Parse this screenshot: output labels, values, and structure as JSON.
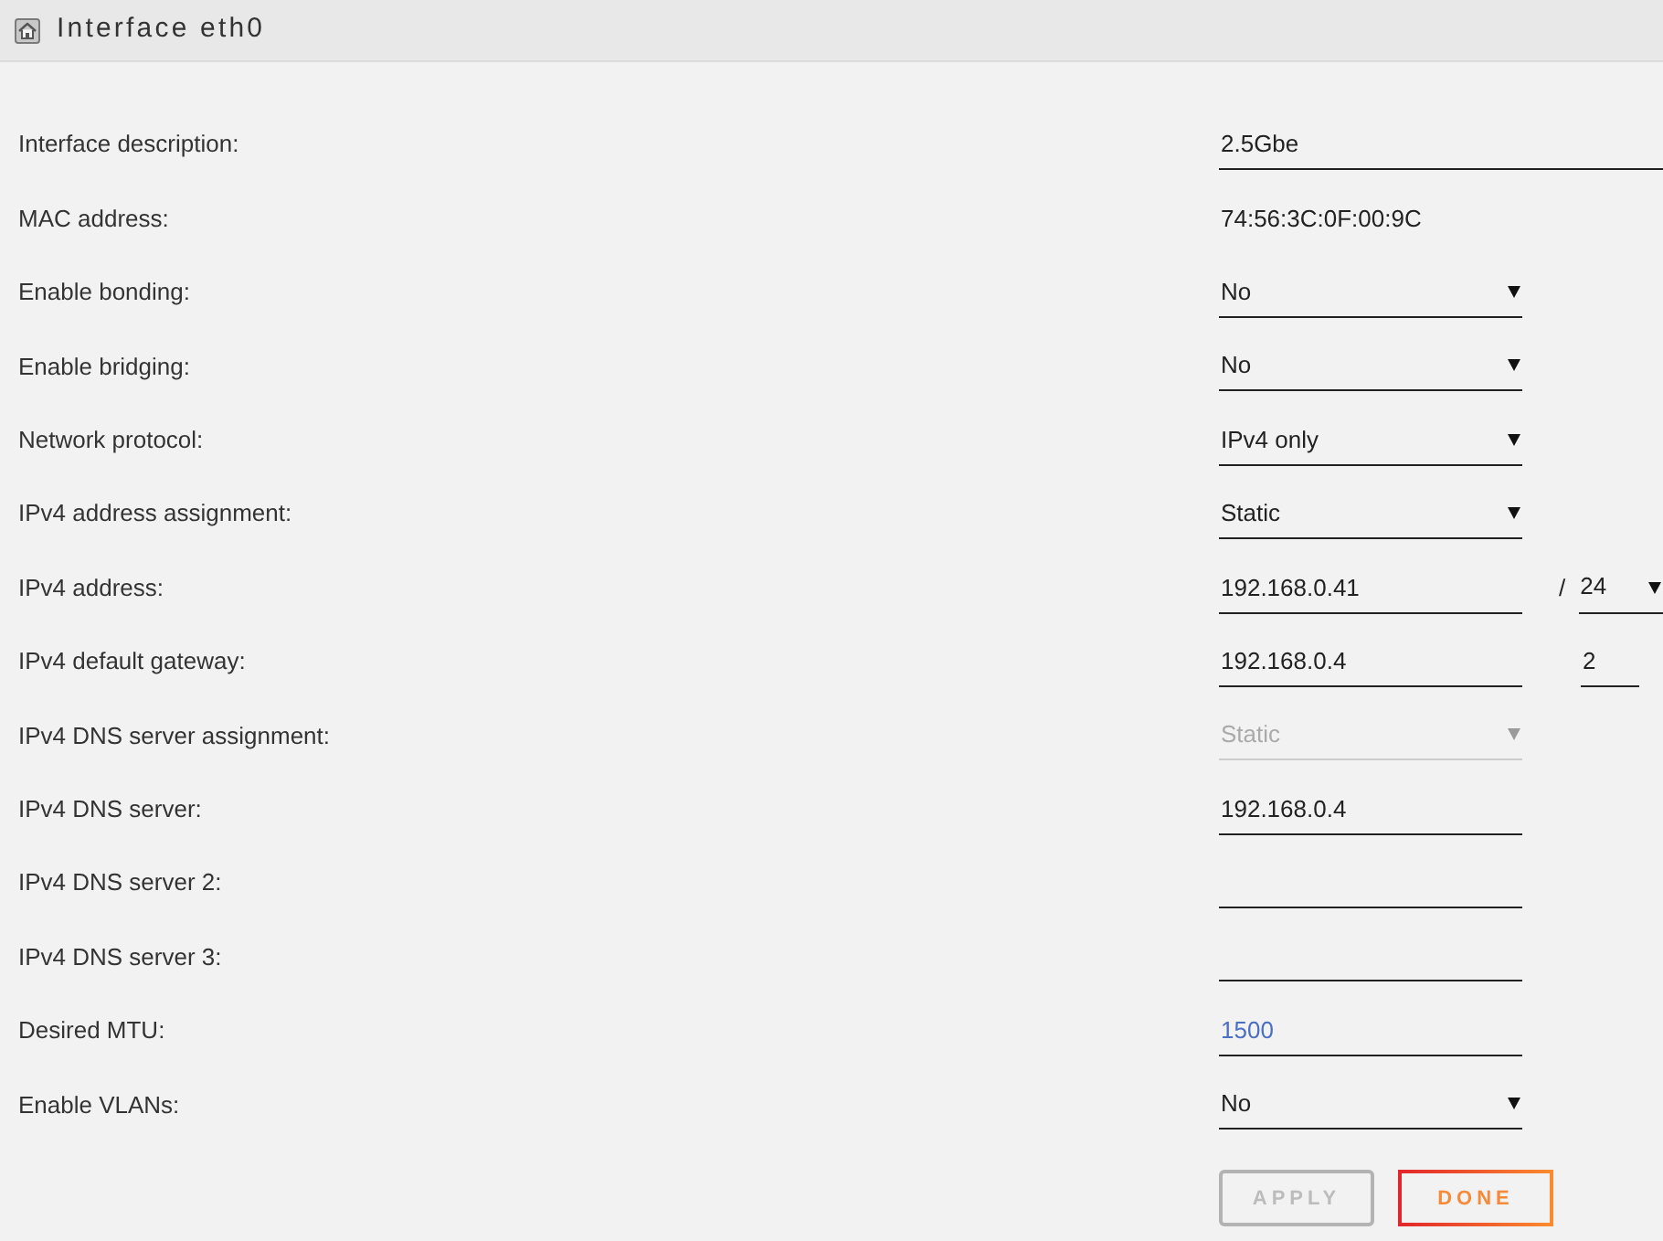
{
  "header": {
    "title": "Interface eth0"
  },
  "rows": [
    {
      "label": "Interface description:",
      "kind": "widefield",
      "value": "2.5Gbe",
      "disabled": false
    },
    {
      "label": "MAC address:",
      "kind": "readout",
      "value": "74:56:3C:0F:00:9C",
      "disabled": false
    },
    {
      "label": "Enable bonding:",
      "kind": "select",
      "value": "No",
      "disabled": false
    },
    {
      "label": "Enable bridging:",
      "kind": "select",
      "value": "No",
      "disabled": false
    },
    {
      "label": "Network protocol:",
      "kind": "select",
      "value": "IPv4 only",
      "disabled": false
    },
    {
      "label": "IPv4 address assignment:",
      "kind": "select",
      "value": "Static",
      "disabled": false
    },
    {
      "label": "IPv4 address:",
      "kind": "textfield",
      "value": "192.168.0.41",
      "disabled": false,
      "extra": {
        "kind": "prefix",
        "separator": "/",
        "value": "24"
      }
    },
    {
      "label": "IPv4 default gateway:",
      "kind": "textfield",
      "value": "192.168.0.4",
      "disabled": false,
      "extra": {
        "kind": "metric",
        "value": "2"
      }
    },
    {
      "label": "IPv4 DNS server assignment:",
      "kind": "select",
      "value": "Static",
      "disabled": true
    },
    {
      "label": "IPv4 DNS server:",
      "kind": "textfield",
      "value": "192.168.0.4",
      "disabled": false
    },
    {
      "label": "IPv4 DNS server 2:",
      "kind": "textfield",
      "disabled": false
    },
    {
      "label": "IPv4 DNS server 3:",
      "kind": "textfield",
      "disabled": false
    },
    {
      "label": "Desired MTU:",
      "kind": "textfield",
      "placeholder": "1500",
      "disabled": false
    },
    {
      "label": "Enable VLANs:",
      "kind": "select",
      "value": "No",
      "disabled": false
    }
  ],
  "buttons": [
    {
      "label": "APPLY",
      "disabled": true
    },
    {
      "label": "DONE",
      "disabled": false
    }
  ]
}
